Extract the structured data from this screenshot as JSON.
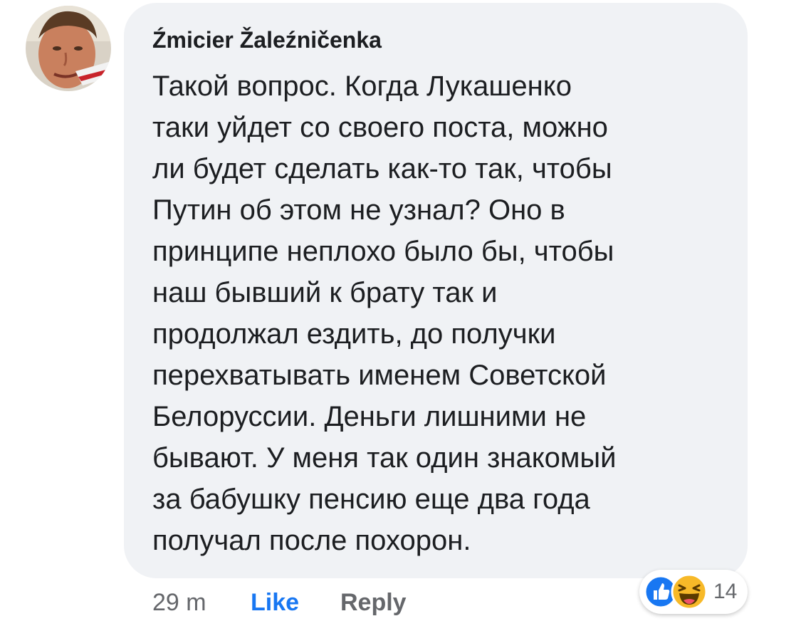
{
  "comment": {
    "author": "Źmicier Žaleźničenka",
    "avatar_icon": "user-avatar-photo",
    "text": "Такой вопрос. Когда Лукашенко\nтаки уйдет со своего поста, можно\nли будет сделать как-то так, чтобы\nПутин об этом не узнал? Оно в\nпринципе неплохо было бы, чтобы\nнаш бывший к брату так и\nпродолжал ездить, до получки\nперехватывать именем Советской\nБелоруссии. Деньги лишними не\nбывают. У меня так один знакомый\nза бабушку пенсию еще два года\nполучал после похорон.",
    "bubble_color": "#f0f2f5"
  },
  "actions": {
    "time": "29 m",
    "like_label": "Like",
    "reply_label": "Reply",
    "like_color": "#1877f2"
  },
  "reactions": {
    "icons": [
      "like-icon",
      "haha-icon"
    ],
    "count": "14"
  }
}
